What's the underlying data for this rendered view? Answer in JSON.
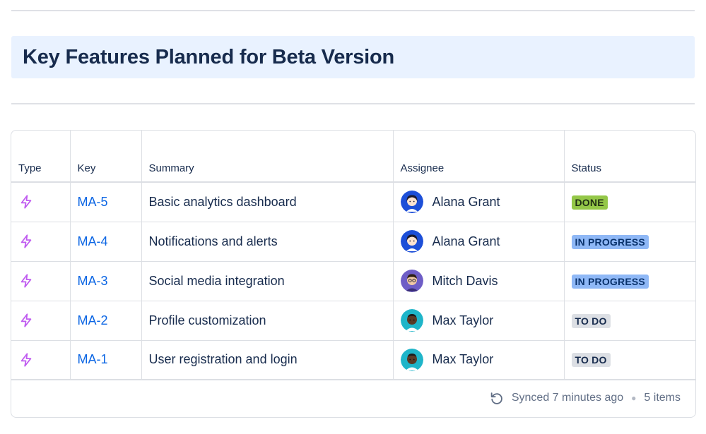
{
  "heading": {
    "title": "Key Features Planned for Beta Version"
  },
  "table": {
    "columns": {
      "type": "Type",
      "key": "Key",
      "summary": "Summary",
      "assignee": "Assignee",
      "status": "Status"
    },
    "rows": [
      {
        "type_icon": "lightning-bolt-icon",
        "key": "MA-5",
        "summary": "Basic analytics dashboard",
        "assignee": "Alana Grant",
        "avatar": "alana",
        "status": "DONE",
        "status_kind": "done"
      },
      {
        "type_icon": "lightning-bolt-icon",
        "key": "MA-4",
        "summary": "Notifications and alerts",
        "assignee": "Alana Grant",
        "avatar": "alana",
        "status": "IN PROGRESS",
        "status_kind": "inprogress"
      },
      {
        "type_icon": "lightning-bolt-icon",
        "key": "MA-3",
        "summary": "Social media integration",
        "assignee": "Mitch Davis",
        "avatar": "mitch",
        "status": "IN PROGRESS",
        "status_kind": "inprogress"
      },
      {
        "type_icon": "lightning-bolt-icon",
        "key": "MA-2",
        "summary": "Profile customization",
        "assignee": "Max Taylor",
        "avatar": "max",
        "status": "TO DO",
        "status_kind": "todo"
      },
      {
        "type_icon": "lightning-bolt-icon",
        "key": "MA-1",
        "summary": "User registration and login",
        "assignee": "Max Taylor",
        "avatar": "max",
        "status": "TO DO",
        "status_kind": "todo"
      }
    ]
  },
  "footer": {
    "synced": "Synced 7 minutes ago",
    "count": "5 items",
    "sync_icon": "refresh-icon"
  },
  "colors": {
    "type_icon": "#c05cf0",
    "link": "#0c66e4",
    "done_bg": "#94c748",
    "done_fg": "#1f2d13",
    "inprogress_bg": "#8fb8f6",
    "inprogress_fg": "#09326c",
    "todo_bg": "#dcdfe4",
    "todo_fg": "#172b4d"
  }
}
